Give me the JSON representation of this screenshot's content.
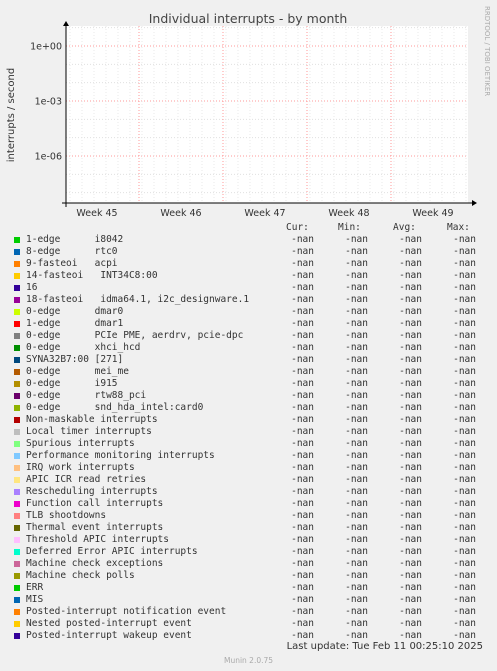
{
  "chart_data": {
    "type": "line",
    "title": "Individual interrupts - by month",
    "ylabel": "interrupts / second",
    "y_scale": "log",
    "y_ticks": [
      "1e+00",
      "1e-03",
      "1e-06"
    ],
    "x_ticks": [
      "Week 45",
      "Week 46",
      "Week 47",
      "Week 48",
      "Week 49"
    ],
    "grid": true,
    "series": []
  },
  "side_text": "RRDTOOL / TOBI OETIKER",
  "legend": {
    "headers": {
      "cur": "Cur:",
      "min": "Min:",
      "avg": "Avg:",
      "max": "Max:"
    },
    "rows": [
      {
        "name": "1-edge      i8042",
        "color": "#00cc00",
        "cur": "-nan",
        "min": "-nan",
        "avg": "-nan",
        "max": "-nan"
      },
      {
        "name": "8-edge      rtc0",
        "color": "#0066b3",
        "cur": "-nan",
        "min": "-nan",
        "avg": "-nan",
        "max": "-nan"
      },
      {
        "name": "9-fasteoi   acpi",
        "color": "#ff8000",
        "cur": "-nan",
        "min": "-nan",
        "avg": "-nan",
        "max": "-nan"
      },
      {
        "name": "14-fasteoi   INT34C8:00",
        "color": "#ffcc00",
        "cur": "-nan",
        "min": "-nan",
        "avg": "-nan",
        "max": "-nan"
      },
      {
        "name": "16",
        "color": "#330099",
        "cur": "-nan",
        "min": "-nan",
        "avg": "-nan",
        "max": "-nan"
      },
      {
        "name": "18-fasteoi   idma64.1, i2c_designware.1",
        "color": "#990099",
        "cur": "-nan",
        "min": "-nan",
        "avg": "-nan",
        "max": "-nan"
      },
      {
        "name": "0-edge      dmar0",
        "color": "#ccff00",
        "cur": "-nan",
        "min": "-nan",
        "avg": "-nan",
        "max": "-nan"
      },
      {
        "name": "1-edge      dmar1",
        "color": "#ff0000",
        "cur": "-nan",
        "min": "-nan",
        "avg": "-nan",
        "max": "-nan"
      },
      {
        "name": "0-edge      PCIe PME, aerdrv, pcie-dpc",
        "color": "#808080",
        "cur": "-nan",
        "min": "-nan",
        "avg": "-nan",
        "max": "-nan"
      },
      {
        "name": "0-edge      xhci_hcd",
        "color": "#008f00",
        "cur": "-nan",
        "min": "-nan",
        "avg": "-nan",
        "max": "-nan"
      },
      {
        "name": "SYNA32B7:00 [271]",
        "color": "#00487d",
        "cur": "-nan",
        "min": "-nan",
        "avg": "-nan",
        "max": "-nan"
      },
      {
        "name": "0-edge      mei_me",
        "color": "#b35a00",
        "cur": "-nan",
        "min": "-nan",
        "avg": "-nan",
        "max": "-nan"
      },
      {
        "name": "0-edge      i915",
        "color": "#b38f00",
        "cur": "-nan",
        "min": "-nan",
        "avg": "-nan",
        "max": "-nan"
      },
      {
        "name": "0-edge      rtw88_pci",
        "color": "#6b006b",
        "cur": "-nan",
        "min": "-nan",
        "avg": "-nan",
        "max": "-nan"
      },
      {
        "name": "0-edge      snd_hda_intel:card0",
        "color": "#8fb300",
        "cur": "-nan",
        "min": "-nan",
        "avg": "-nan",
        "max": "-nan"
      },
      {
        "name": "Non-maskable interrupts",
        "color": "#b30000",
        "cur": "-nan",
        "min": "-nan",
        "avg": "-nan",
        "max": "-nan"
      },
      {
        "name": "Local timer interrupts",
        "color": "#bebebe",
        "cur": "-nan",
        "min": "-nan",
        "avg": "-nan",
        "max": "-nan"
      },
      {
        "name": "Spurious interrupts",
        "color": "#80ff80",
        "cur": "-nan",
        "min": "-nan",
        "avg": "-nan",
        "max": "-nan"
      },
      {
        "name": "Performance monitoring interrupts",
        "color": "#80c9ff",
        "cur": "-nan",
        "min": "-nan",
        "avg": "-nan",
        "max": "-nan"
      },
      {
        "name": "IRQ work interrupts",
        "color": "#ffc080",
        "cur": "-nan",
        "min": "-nan",
        "avg": "-nan",
        "max": "-nan"
      },
      {
        "name": "APIC ICR read retries",
        "color": "#ffe680",
        "cur": "-nan",
        "min": "-nan",
        "avg": "-nan",
        "max": "-nan"
      },
      {
        "name": "Rescheduling interrupts",
        "color": "#aa80ff",
        "cur": "-nan",
        "min": "-nan",
        "avg": "-nan",
        "max": "-nan"
      },
      {
        "name": "Function call interrupts",
        "color": "#ee00cc",
        "cur": "-nan",
        "min": "-nan",
        "avg": "-nan",
        "max": "-nan"
      },
      {
        "name": "TLB shootdowns",
        "color": "#ff8080",
        "cur": "-nan",
        "min": "-nan",
        "avg": "-nan",
        "max": "-nan"
      },
      {
        "name": "Thermal event interrupts",
        "color": "#666600",
        "cur": "-nan",
        "min": "-nan",
        "avg": "-nan",
        "max": "-nan"
      },
      {
        "name": "Threshold APIC interrupts",
        "color": "#ffbfff",
        "cur": "-nan",
        "min": "-nan",
        "avg": "-nan",
        "max": "-nan"
      },
      {
        "name": "Deferred Error APIC interrupts",
        "color": "#00ffcc",
        "cur": "-nan",
        "min": "-nan",
        "avg": "-nan",
        "max": "-nan"
      },
      {
        "name": "Machine check exceptions",
        "color": "#cc6699",
        "cur": "-nan",
        "min": "-nan",
        "avg": "-nan",
        "max": "-nan"
      },
      {
        "name": "Machine check polls",
        "color": "#999900",
        "cur": "-nan",
        "min": "-nan",
        "avg": "-nan",
        "max": "-nan"
      },
      {
        "name": "ERR",
        "color": "#00cc00",
        "cur": "-nan",
        "min": "-nan",
        "avg": "-nan",
        "max": "-nan"
      },
      {
        "name": "MIS",
        "color": "#0066b3",
        "cur": "-nan",
        "min": "-nan",
        "avg": "-nan",
        "max": "-nan"
      },
      {
        "name": "Posted-interrupt notification event",
        "color": "#ff8000",
        "cur": "-nan",
        "min": "-nan",
        "avg": "-nan",
        "max": "-nan"
      },
      {
        "name": "Nested posted-interrupt event",
        "color": "#ffcc00",
        "cur": "-nan",
        "min": "-nan",
        "avg": "-nan",
        "max": "-nan"
      },
      {
        "name": "Posted-interrupt wakeup event",
        "color": "#330099",
        "cur": "-nan",
        "min": "-nan",
        "avg": "-nan",
        "max": "-nan"
      }
    ]
  },
  "footer": {
    "last_update": "Last update: Tue Feb 11 00:25:10 2025",
    "version": "Munin 2.0.75"
  }
}
